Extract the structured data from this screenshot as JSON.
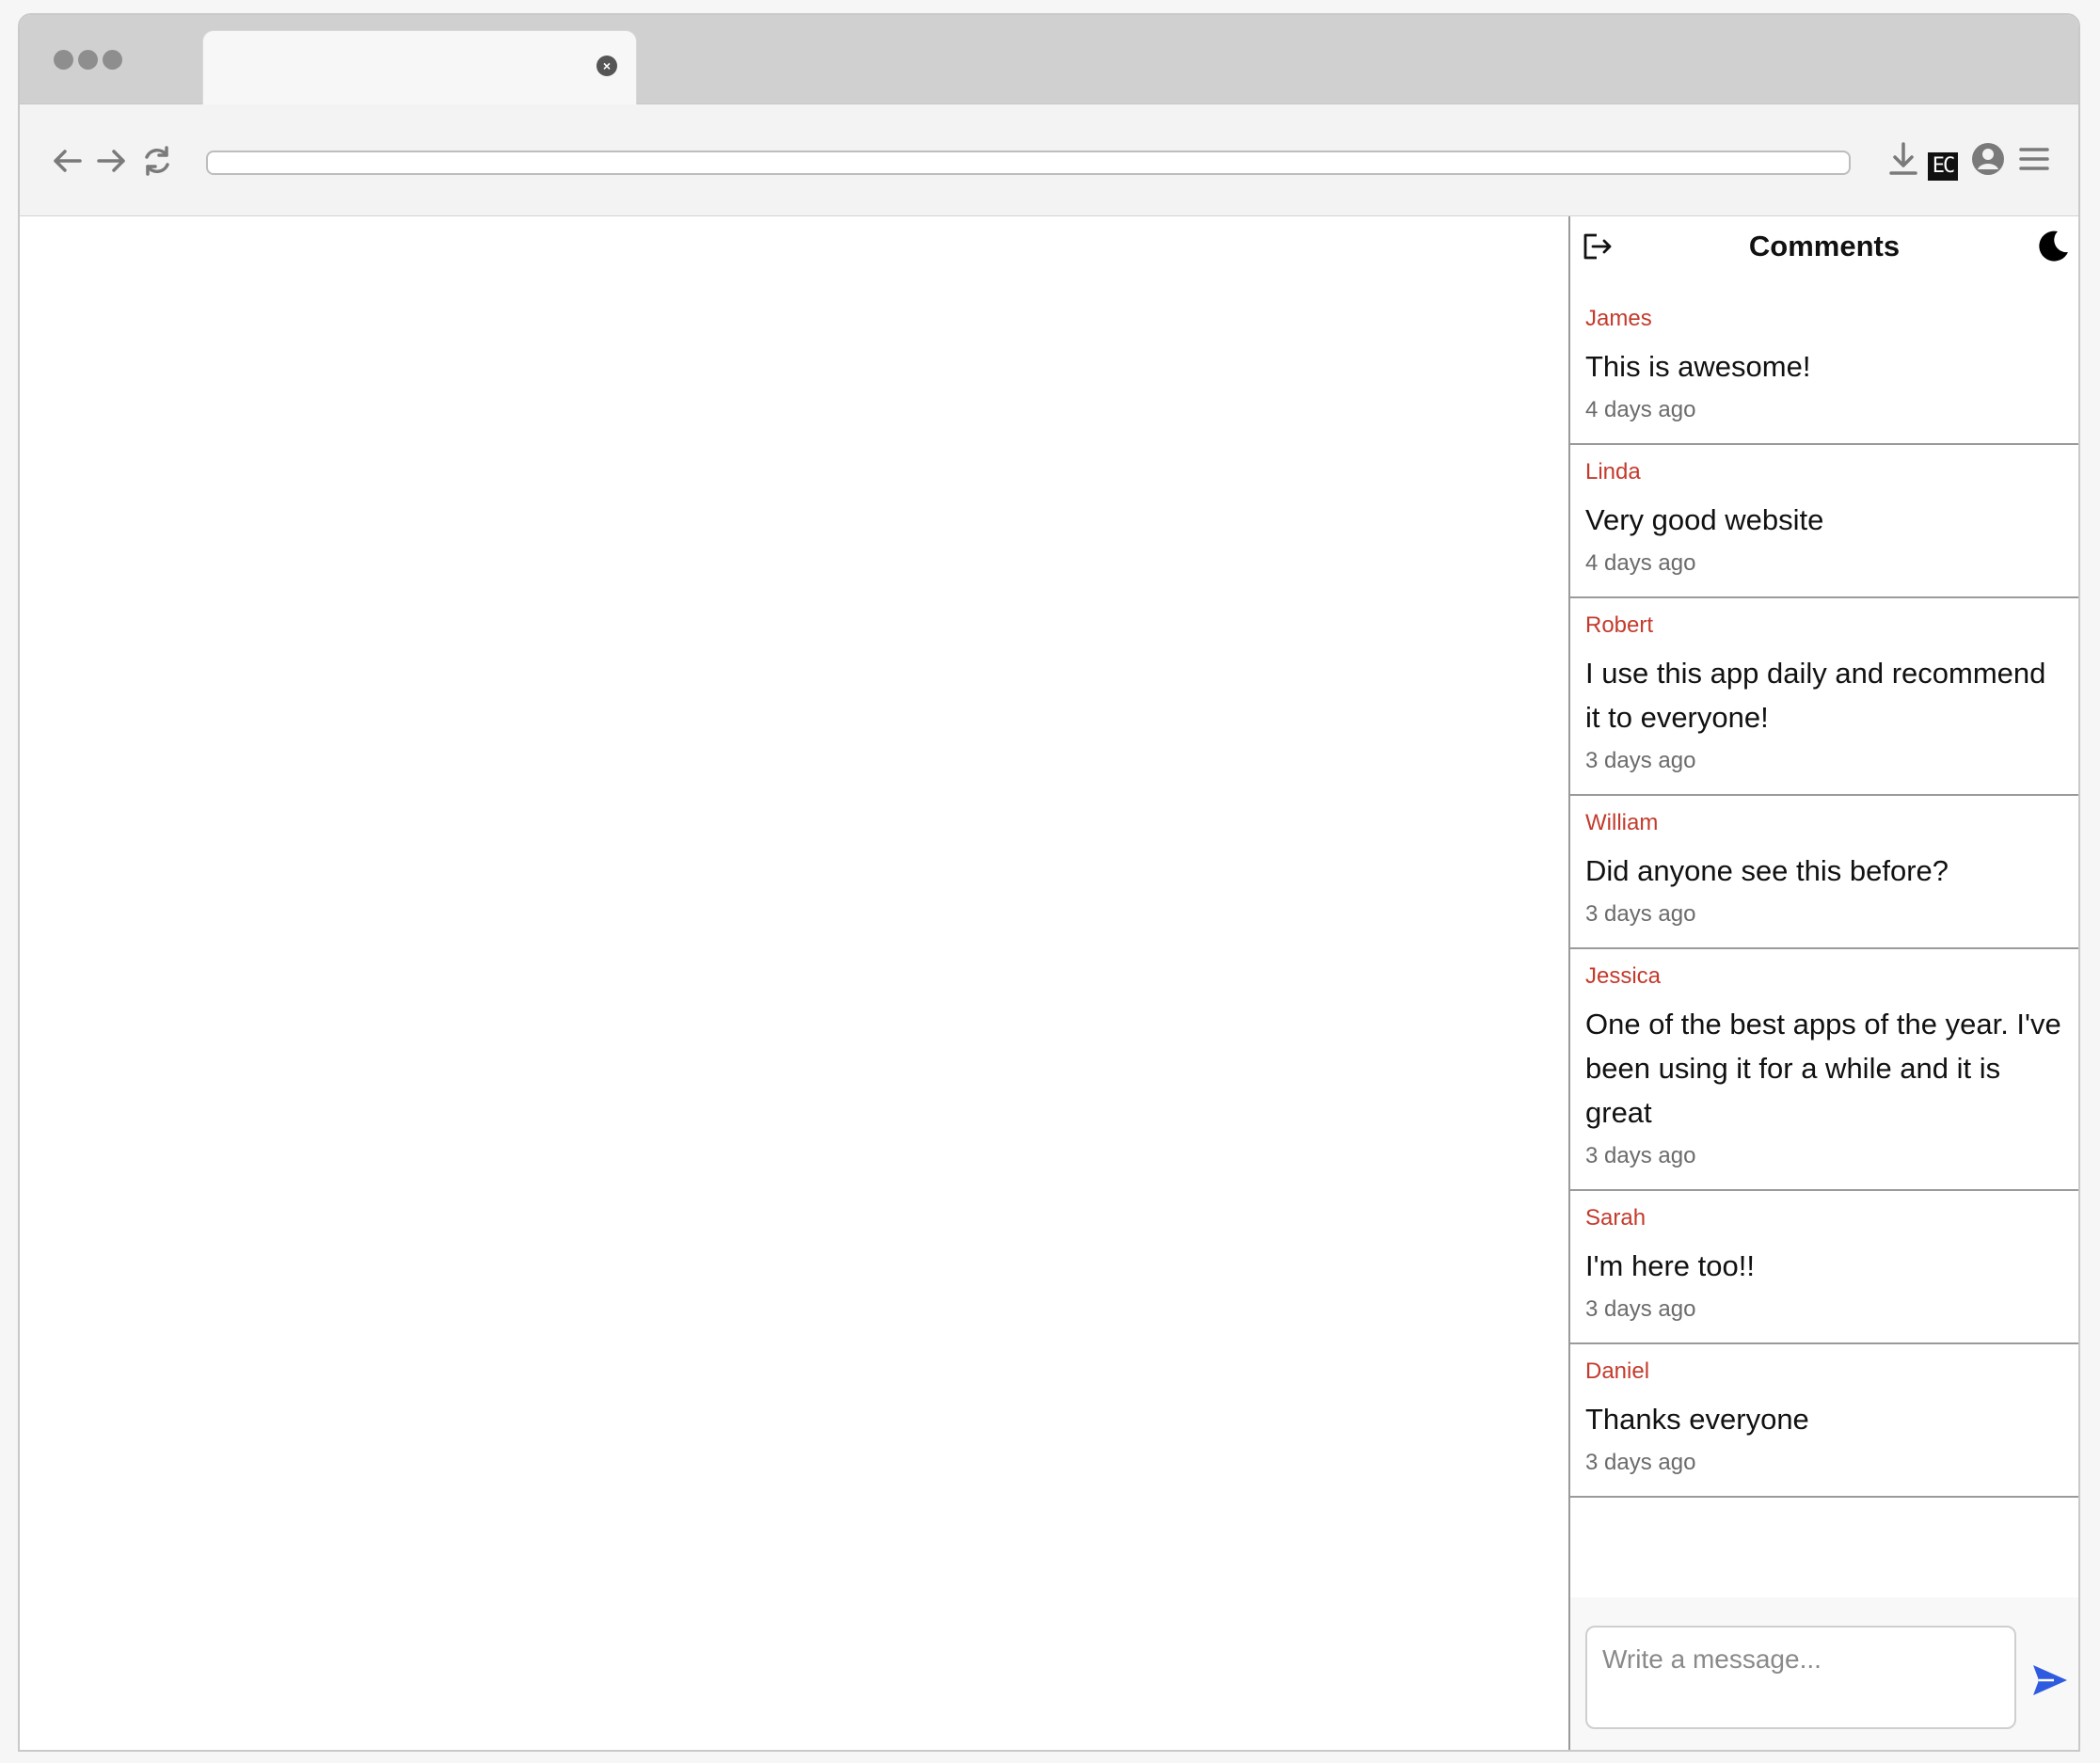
{
  "browser": {
    "tab_title": "",
    "address": "",
    "extension_badge": "EC"
  },
  "icons": {
    "back": "arrow-left-icon",
    "forward": "arrow-right-icon",
    "reload": "reload-icon",
    "download": "download-icon",
    "profile": "user-circle-icon",
    "menu": "hamburger-menu-icon",
    "logout": "logout-icon",
    "theme": "moon-icon",
    "send": "send-icon"
  },
  "panel": {
    "title": "Comments",
    "comments": [
      {
        "name": "James",
        "text": "This is awesome!",
        "time": "4 days ago"
      },
      {
        "name": "Linda",
        "text": "Very good website",
        "time": "4 days ago"
      },
      {
        "name": "Robert",
        "text": "I use this app daily and recommend it to everyone!",
        "time": "3 days ago"
      },
      {
        "name": "William",
        "text": "Did anyone see this before?",
        "time": "3 days ago"
      },
      {
        "name": "Jessica",
        "text": "One of the best apps of the year. I've been using it for a while and it is great",
        "time": "3 days ago"
      },
      {
        "name": "Sarah",
        "text": "I'm here too!!",
        "time": "3 days ago"
      },
      {
        "name": "Daniel",
        "text": "Thanks everyone",
        "time": "3 days ago"
      }
    ],
    "composer": {
      "placeholder": "Write a message...",
      "value": ""
    }
  },
  "colors": {
    "author_name": "#c43a2c",
    "send_accent": "#2f5be0"
  }
}
